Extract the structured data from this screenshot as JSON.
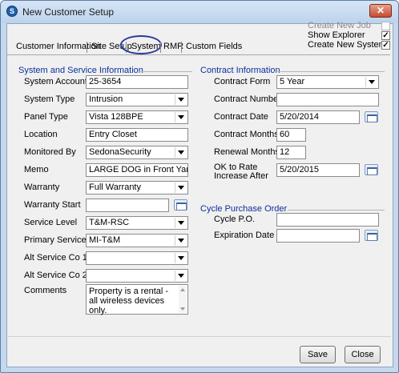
{
  "window": {
    "title": "New Customer Setup",
    "close_glyph": "✕"
  },
  "top_options": {
    "create_new_job": {
      "label": "Create New Job",
      "checked": false
    },
    "show_explorer": {
      "label": "Show Explorer",
      "checked": true
    },
    "create_new_system": {
      "label": "Create New System",
      "checked": true
    }
  },
  "tabs": [
    "Customer Information",
    "Site Setup",
    "System",
    "RMR",
    "Custom Fields"
  ],
  "active_tab": "System",
  "system_service": {
    "title": "System and Service Information",
    "system_account": {
      "label": "System Account",
      "value": "25-3654"
    },
    "system_type": {
      "label": "System Type",
      "value": "Intrusion"
    },
    "panel_type": {
      "label": "Panel Type",
      "value": "Vista 128BPE"
    },
    "location": {
      "label": "Location",
      "value": "Entry Closet"
    },
    "monitored_by": {
      "label": "Monitored By",
      "value": "SedonaSecurity"
    },
    "memo": {
      "label": "Memo",
      "value": "LARGE DOG in Front Yard"
    },
    "warranty": {
      "label": "Warranty",
      "value": "Full Warranty"
    },
    "warranty_start": {
      "label": "Warranty Start",
      "value": ""
    },
    "service_level": {
      "label": "Service Level",
      "value": "T&M-RSC"
    },
    "primary_service_co": {
      "label": "Primary Service Co",
      "value": "MI-T&M"
    },
    "alt_service_co_1": {
      "label": "Alt Service Co 1",
      "value": ""
    },
    "alt_service_co_2": {
      "label": "Alt Service Co 2",
      "value": ""
    },
    "comments": {
      "label": "Comments",
      "value": "Property is a rental - all wireless devices only."
    }
  },
  "contract": {
    "title": "Contract Information",
    "contract_form": {
      "label": "Contract Form",
      "value": "5 Year"
    },
    "contract_number": {
      "label": "Contract Number",
      "value": ""
    },
    "contract_date": {
      "label": "Contract Date",
      "value": "5/20/2014"
    },
    "contract_months": {
      "label": "Contract Months",
      "value": "60"
    },
    "renewal_months": {
      "label": "Renewal Months",
      "value": "12"
    },
    "ok_to_rate": {
      "label_line1": "OK to Rate",
      "label_line2": "Increase After",
      "value": "5/20/2015"
    }
  },
  "cycle_po": {
    "title": "Cycle Purchase Order",
    "cycle_po": {
      "label": "Cycle P.O.",
      "value": ""
    },
    "expiration_date": {
      "label": "Expiration Date",
      "value": ""
    }
  },
  "buttons": {
    "save": "Save",
    "close": "Close"
  },
  "icons": {
    "app": "sedona-app-icon",
    "calendar": "calendar-icon",
    "dropdown": "chevron-down-icon"
  }
}
